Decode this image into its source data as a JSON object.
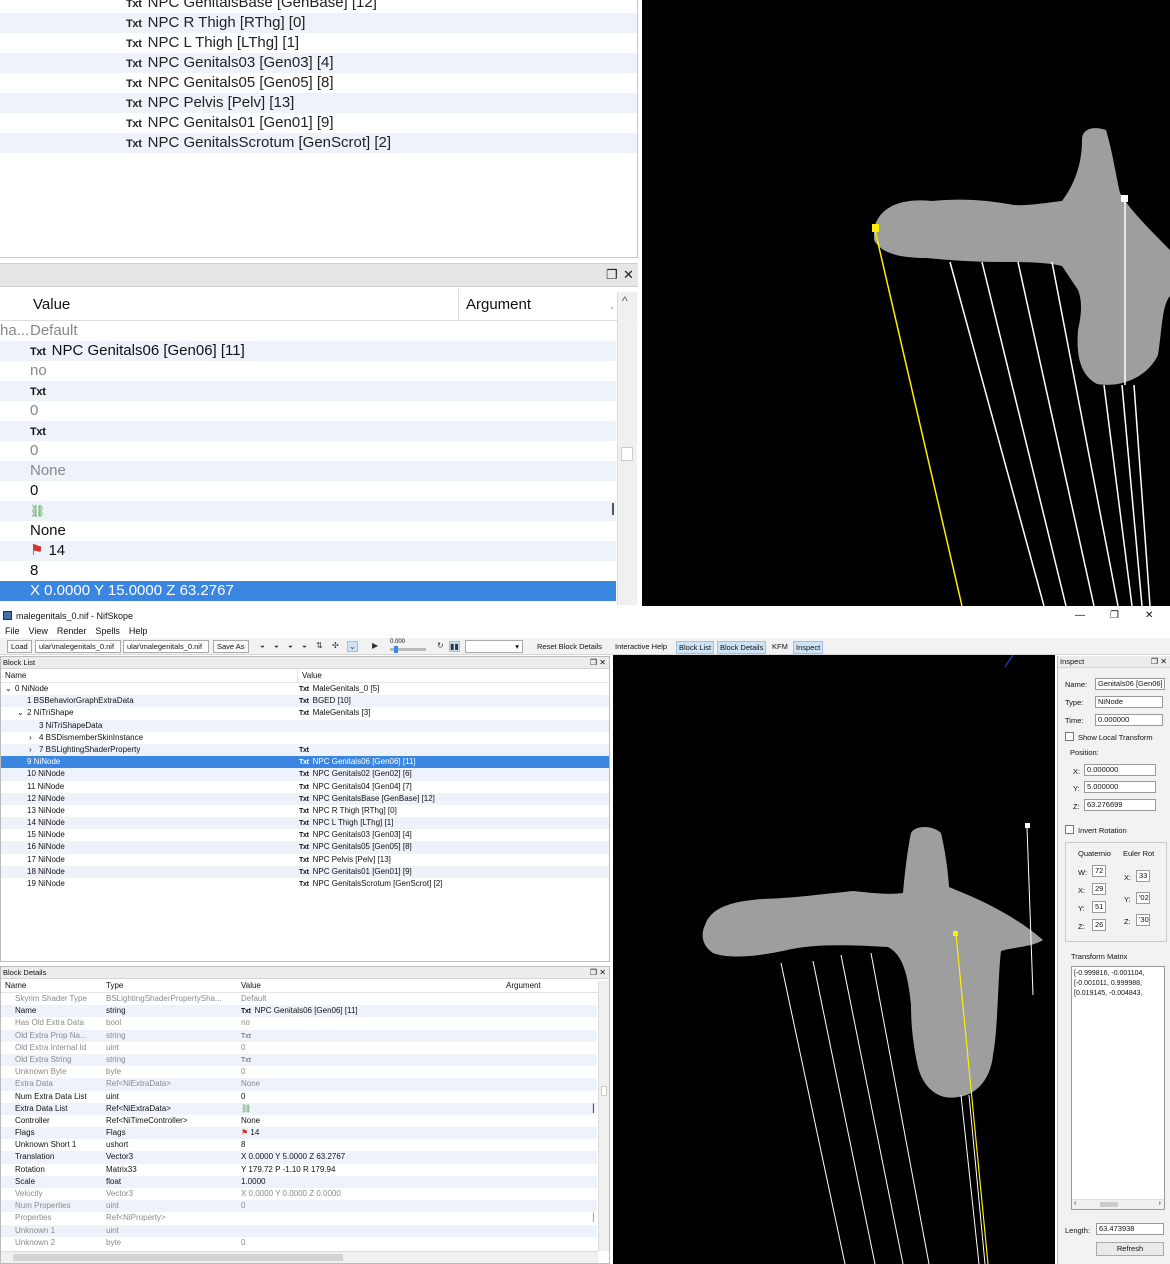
{
  "zoom_block_list": {
    "rows": [
      "NPC GenitalsBase [GenBase] [12]",
      "NPC R Thigh [RThg] [0]",
      "NPC L Thigh [LThg] [1]",
      "NPC Genitals03 [Gen03] [4]",
      "NPC Genitals05 [Gen05] [8]",
      "NPC Pelvis [Pelv] [13]",
      "NPC Genitals01 [Gen01] [9]",
      "NPC GenitalsScrotum [GenScrot] [2]"
    ],
    "txt_icon": "Txt"
  },
  "zoom_details": {
    "col_value": "Value",
    "col_argument": "Argument",
    "cut_name": "ha...",
    "rows": [
      "Default",
      "NPC Genitals06 [Gen06] [11]",
      "no",
      "",
      "0",
      "",
      "0",
      "None",
      "0",
      "",
      "None",
      "14",
      "8",
      "X 0.0000 Y 15.0000 Z 63.2767"
    ]
  },
  "window": {
    "title": "malegenitals_0.nif - NifSkope",
    "min": "—",
    "max": "❐",
    "close": "✕"
  },
  "menu": [
    "File",
    "View",
    "Render",
    "Spells",
    "Help"
  ],
  "toolbar": {
    "load": "Load",
    "path1": "ular\\malegenitals_0.nif",
    "path2": "ular\\malegenitals_0.nif",
    "save_as": "Save As",
    "time": "0.000",
    "reset": "Reset Block Details",
    "help": "Interactive Help",
    "tabs": [
      "Block List",
      "Block Details",
      "KFM",
      "Inspect"
    ]
  },
  "block_list": {
    "title": "Block List",
    "col_name": "Name",
    "col_value": "Value",
    "rows": [
      {
        "name": "0 NiNode",
        "value": "MaleGenitals_0 [5]",
        "indent": 0,
        "exp": "v"
      },
      {
        "name": "1 BSBehaviorGraphExtraData",
        "value": "BGED [10]",
        "indent": 1,
        "exp": ""
      },
      {
        "name": "2 NiTriShape",
        "value": "MaleGenitals [3]",
        "indent": 1,
        "exp": "v"
      },
      {
        "name": "3 NiTriShapeData",
        "value": "",
        "indent": 2,
        "exp": ""
      },
      {
        "name": "4 BSDismemberSkinInstance",
        "value": "",
        "indent": 2,
        "exp": ">"
      },
      {
        "name": "7 BSLightingShaderProperty",
        "value": "",
        "indent": 2,
        "exp": ">",
        "txt": true
      },
      {
        "name": "9 NiNode",
        "value": "NPC Genitals06 [Gen06] [11]",
        "indent": 1,
        "exp": ""
      },
      {
        "name": "10 NiNode",
        "value": "NPC Genitals02 [Gen02] [6]",
        "indent": 1,
        "exp": ""
      },
      {
        "name": "11 NiNode",
        "value": "NPC Genitals04 [Gen04] [7]",
        "indent": 1,
        "exp": ""
      },
      {
        "name": "12 NiNode",
        "value": "NPC GenitalsBase [GenBase] [12]",
        "indent": 1,
        "exp": ""
      },
      {
        "name": "13 NiNode",
        "value": "NPC R Thigh [RThg] [0]",
        "indent": 1,
        "exp": ""
      },
      {
        "name": "14 NiNode",
        "value": "NPC L Thigh [LThg] [1]",
        "indent": 1,
        "exp": ""
      },
      {
        "name": "15 NiNode",
        "value": "NPC Genitals03 [Gen03] [4]",
        "indent": 1,
        "exp": ""
      },
      {
        "name": "16 NiNode",
        "value": "NPC Genitals05 [Gen05] [8]",
        "indent": 1,
        "exp": ""
      },
      {
        "name": "17 NiNode",
        "value": "NPC Pelvis [Pelv] [13]",
        "indent": 1,
        "exp": ""
      },
      {
        "name": "18 NiNode",
        "value": "NPC Genitals01 [Gen01] [9]",
        "indent": 1,
        "exp": ""
      },
      {
        "name": "19 NiNode",
        "value": "NPC GenitalsScrotum [GenScrot] [2]",
        "indent": 1,
        "exp": ""
      }
    ]
  },
  "block_details": {
    "title": "Block Details",
    "cols": [
      "Name",
      "Type",
      "Value",
      "Argument"
    ],
    "rows": [
      {
        "name": "Skyrim Shader Type",
        "type": "BSLightingShaderPropertySha...",
        "value": "Default",
        "dim": true
      },
      {
        "name": "Name",
        "type": "string",
        "value": "NPC Genitals06 [Gen06] [11]",
        "dim": false,
        "txt": true
      },
      {
        "name": "Has Old Extra Data",
        "type": "bool",
        "value": "no",
        "dim": true
      },
      {
        "name": "Old Extra Prop Na...",
        "type": "string",
        "value": "",
        "dim": true,
        "txt": true
      },
      {
        "name": "Old Extra Internal Id",
        "type": "uint",
        "value": "0",
        "dim": true
      },
      {
        "name": "Old Extra String",
        "type": "string",
        "value": "",
        "dim": true,
        "txt": true
      },
      {
        "name": "Unknown Byte",
        "type": "byte",
        "value": "0",
        "dim": true
      },
      {
        "name": "Extra Data",
        "type": "Ref<NiExtraData>",
        "value": "None",
        "dim": true
      },
      {
        "name": "Num Extra Data List",
        "type": "uint",
        "value": "0",
        "dim": false
      },
      {
        "name": "Extra Data List",
        "type": "Ref<NiExtraData>",
        "value": "",
        "dim": false,
        "icon": "link"
      },
      {
        "name": "Controller",
        "type": "Ref<NiTimeController>",
        "value": "None",
        "dim": false
      },
      {
        "name": "Flags",
        "type": "Flags",
        "value": "14",
        "dim": false,
        "icon": "flag"
      },
      {
        "name": "Unknown Short 1",
        "type": "ushort",
        "value": "8",
        "dim": false
      },
      {
        "name": "Translation",
        "type": "Vector3",
        "value": "X 0.0000 Y 5.0000 Z 63.2767",
        "dim": false
      },
      {
        "name": "Rotation",
        "type": "Matrix33",
        "value": "Y 179.72 P -1.10 R 179.94",
        "dim": false
      },
      {
        "name": "Scale",
        "type": "float",
        "value": "1.0000",
        "dim": false
      },
      {
        "name": "Velocity",
        "type": "Vector3",
        "value": "X 0.0000 Y 0.0000 Z 0.0000",
        "dim": true
      },
      {
        "name": "Num Properties",
        "type": "uint",
        "value": "0",
        "dim": true
      },
      {
        "name": "Properties",
        "type": "Ref<NiProperty>",
        "value": "",
        "dim": true
      },
      {
        "name": "Unknown 1",
        "type": "uint",
        "value": "",
        "dim": true
      },
      {
        "name": "Unknown 2",
        "type": "byte",
        "value": "0",
        "dim": true
      }
    ]
  },
  "inspect": {
    "title": "Inspect",
    "name_label": "Name:",
    "name_value": "Genitals06 [Gen06]",
    "type_label": "Type:",
    "type_value": "NiNode",
    "time_label": "Time:",
    "time_value": "0.000000",
    "show_local": "Show Local Transform",
    "position": "Position:",
    "x_label": "X:",
    "x_value": "0.000000",
    "y_label": "Y:",
    "y_value": "5.000000",
    "z_label": "Z:",
    "z_value": "63.276699",
    "invert_rotation": "Invert Rotation",
    "quaternion": "Quaternio",
    "euler": "Euler Rot",
    "q_w": "W:",
    "q_w_val": "72",
    "q_x": "X:",
    "q_x_val": "29",
    "q_y": "Y:",
    "q_y_val": "51",
    "q_z": "Z:",
    "q_z_val": "26",
    "e_x": "X:",
    "e_x_val": "33",
    "e_y": "Y:",
    "e_y_val": "'02",
    "e_z": "Z:",
    "e_z_val": "'30",
    "matrix_label": "Transform Matrix",
    "matrix_lines": [
      "[-0.999816, -0.001104,",
      "[-0.001011, 0.999988,",
      "[0.019145, -0.004843,"
    ],
    "length_label": "Length:",
    "length_value": "63.473938",
    "refresh": "Refresh"
  },
  "colors": {
    "selection": "#3b86e0",
    "viewport_bg": "#000000",
    "mesh": "#9e9e9e",
    "bone_selected": "#ffee00",
    "bone": "#ffffff"
  }
}
